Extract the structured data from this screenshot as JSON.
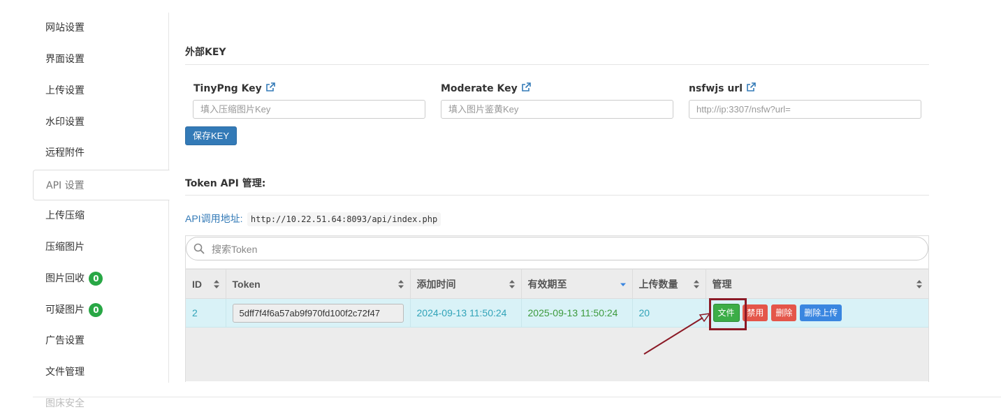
{
  "sidebar": {
    "items": [
      {
        "label": "网站设置"
      },
      {
        "label": "界面设置"
      },
      {
        "label": "上传设置"
      },
      {
        "label": "水印设置"
      },
      {
        "label": "远程附件"
      },
      {
        "label": "API 设置"
      },
      {
        "label": "上传压缩"
      },
      {
        "label": "压缩图片"
      },
      {
        "label": "图片回收",
        "badge": "0"
      },
      {
        "label": "可疑图片",
        "badge": "0"
      },
      {
        "label": "广告设置"
      },
      {
        "label": "文件管理"
      },
      {
        "label": "图床安全"
      }
    ],
    "active_index": 5
  },
  "external_key": {
    "title": "外部KEY",
    "fields": [
      {
        "label": "TinyPng Key",
        "placeholder": "填入压缩图片Key",
        "value": ""
      },
      {
        "label": "Moderate Key",
        "placeholder": "填入图片鉴黄Key",
        "value": ""
      },
      {
        "label": "nsfwjs url",
        "placeholder": "http://ip:3307/nsfw?url=",
        "value": ""
      }
    ],
    "save_button": "保存KEY"
  },
  "token_api": {
    "title": "Token API 管理:",
    "api_url_label": "API调用地址:",
    "api_url": "http://10.22.51.64:8093/api/index.php",
    "search_placeholder": "搜索Token",
    "columns": [
      "ID",
      "Token",
      "添加时间",
      "有效期至",
      "上传数量",
      "管理"
    ],
    "rows": [
      {
        "id": "2",
        "token": "5dff7f4f6a57ab9f970fd100f2c72f47",
        "added": "2024-09-13 11:50:24",
        "expires": "2025-09-13 11:50:24",
        "uploads": "20",
        "actions": [
          "文件",
          "禁用",
          "删除",
          "删除上传"
        ]
      }
    ]
  },
  "colors": {
    "primary": "#337ab7",
    "success": "#3cad47",
    "danger": "#e4564a",
    "info_row": "#d9f2f7",
    "annotation": "#8b1a26"
  }
}
